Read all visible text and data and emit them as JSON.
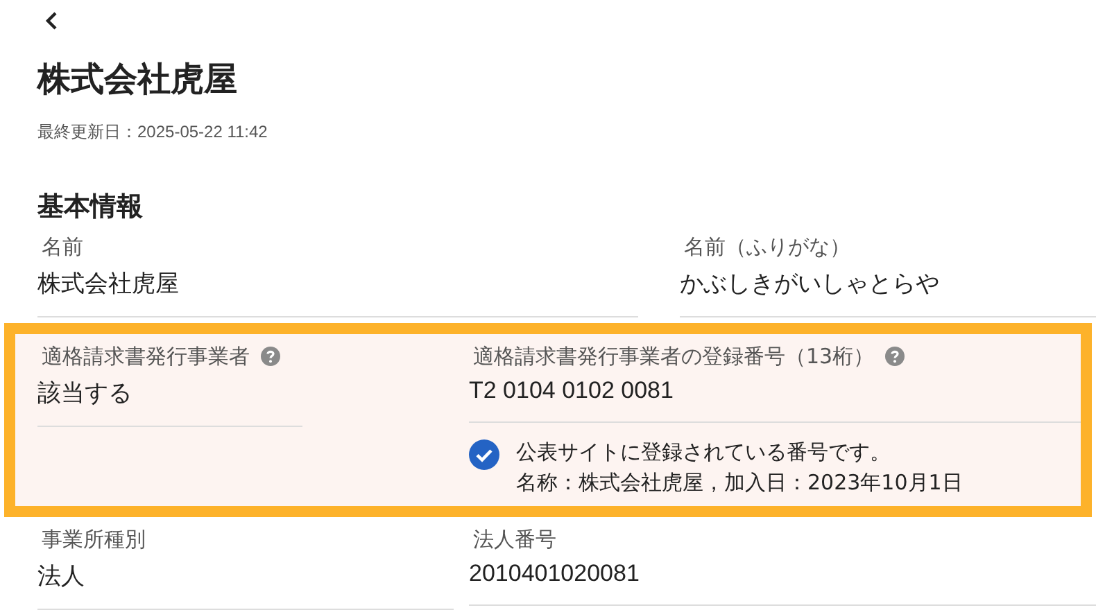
{
  "title": "株式会社虎屋",
  "last_updated": "最終更新日：2025-05-22 11:42",
  "section": {
    "title": "基本情報",
    "rows": [
      {
        "highlighted": false,
        "fields": [
          {
            "label": "名前",
            "value": "株式会社虎屋",
            "help": false
          },
          {
            "label": "名前（ふりがな）",
            "value": "かぶしきがいしゃとらや",
            "help": false
          }
        ]
      },
      {
        "highlighted": true,
        "fields": [
          {
            "label": "適格請求書発行事業者",
            "value": "該当する",
            "help": true
          },
          {
            "label": "適格請求書発行事業者の登録番号（13桁）",
            "value": "T2 0104 0102 0081",
            "help": true,
            "note": {
              "verified": true,
              "text": "公表サイトに登録されている番号です。",
              "detail": "名称：株式会社虎屋，加入日：2023年10月1日"
            }
          }
        ]
      },
      {
        "highlighted": false,
        "fields": [
          {
            "label": "事業所種別",
            "value": "法人",
            "help": false
          },
          {
            "label": "法人番号",
            "value": "2010401020081",
            "help": false
          }
        ]
      }
    ]
  }
}
